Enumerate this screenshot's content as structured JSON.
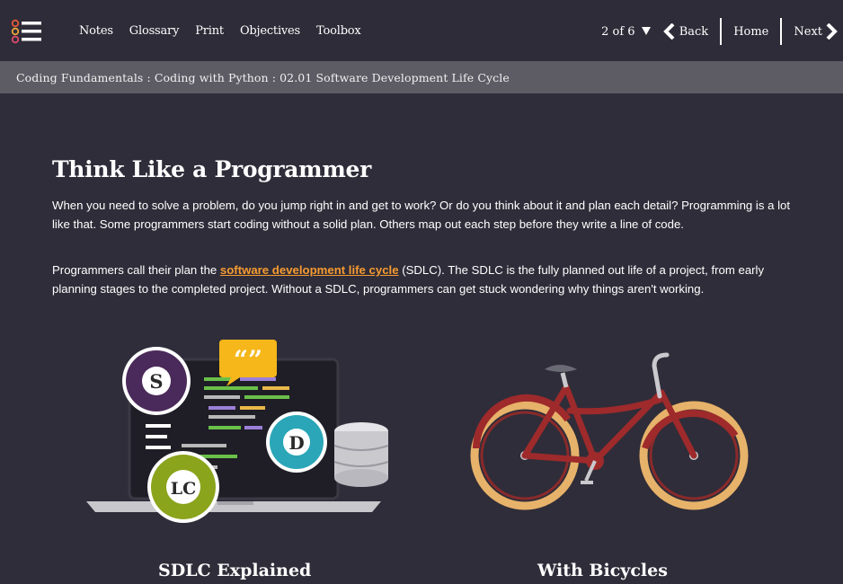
{
  "nav": {
    "items": [
      "Notes",
      "Glossary",
      "Print",
      "Objectives",
      "Toolbox"
    ],
    "page_count": "2 of 6",
    "back_label": "Back",
    "home_label": "Home",
    "next_label": "Next"
  },
  "breadcrumb": "Coding Fundamentals : Coding with Python : 02.01 Software Development Life Cycle",
  "main": {
    "title": "Think Like a Programmer",
    "para1": "When you need to solve a problem, do you jump right in and get to work? Or do you think about it and plan each detail? Programming is a lot like that. Some programmers start coding without a solid plan. Others map out each step before they write a line of code.",
    "para2_before": "Programmers call their plan the ",
    "para2_link": "software development life cycle",
    "para2_after": " (SDLC). The SDLC is the fully planned out life of a project, from early planning stages to the completed project. Without a SDLC, programmers can get stuck wondering why things aren't working.",
    "badges": {
      "s": "S",
      "d": "D",
      "lc": "LC"
    },
    "caption_left": "SDLC Explained",
    "caption_right": "With Bicycles"
  },
  "colors": {
    "background": "#2f2d39",
    "breadcrumb_bar": "#5d5b64",
    "link": "#f79b31",
    "badge_s": "#4a2a5a",
    "badge_d": "#2aa6b8",
    "badge_lc": "#8aa41c",
    "bike_frame": "#9e2a2b",
    "bike_tire": "#e7b26a"
  },
  "icons": {
    "menu": "list-menu-icon",
    "page_dropdown": "triangle-down-icon",
    "back": "chevron-left-icon",
    "next": "chevron-right-icon"
  }
}
